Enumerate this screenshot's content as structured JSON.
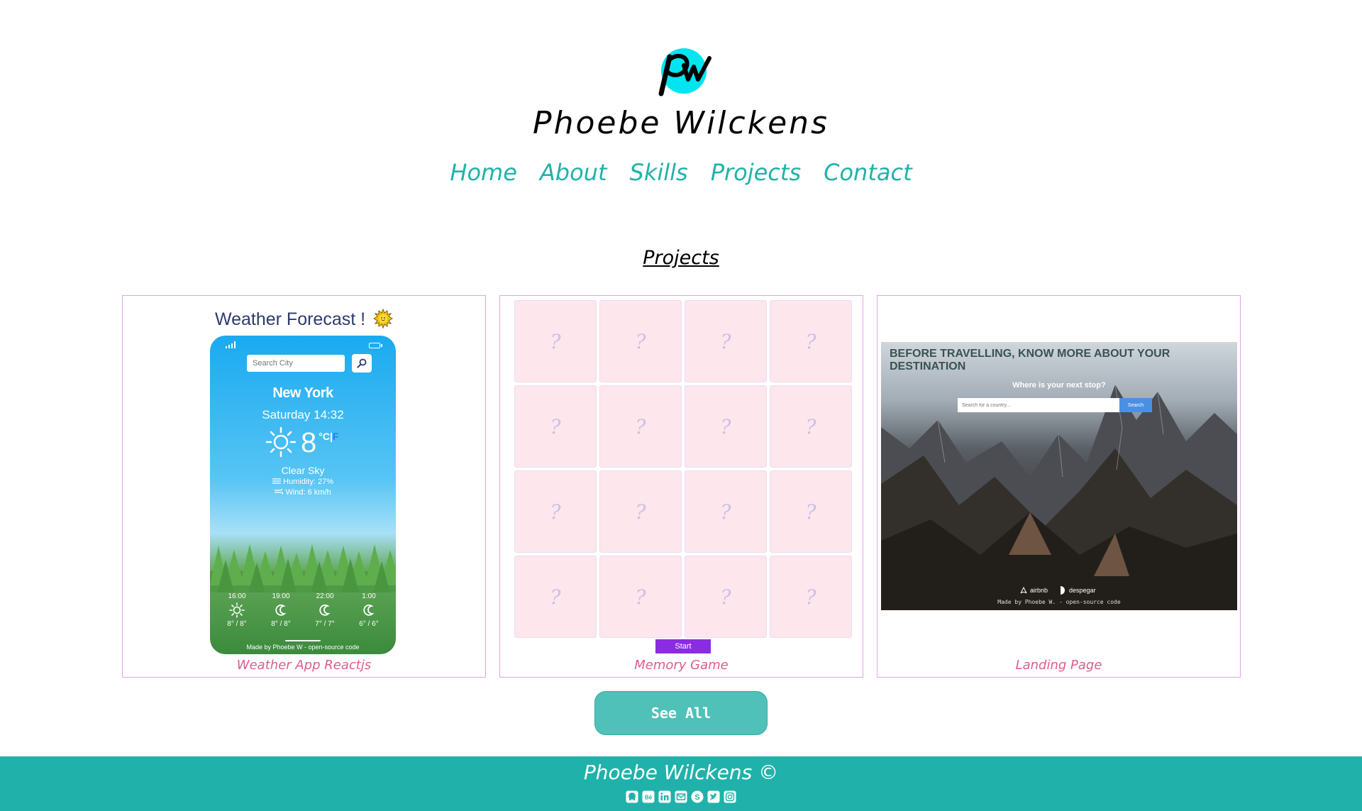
{
  "header": {
    "logo_text": "pw",
    "site_title": "Phoebe Wilckens",
    "nav": [
      "Home",
      "About",
      "Skills",
      "Projects",
      "Contact"
    ]
  },
  "projects": {
    "title": "Projects",
    "cards": [
      {
        "caption": "Weather App Reactjs",
        "preview": {
          "title": "Weather Forecast !",
          "search_placeholder": "Search City",
          "city": "New York",
          "date": "Saturday 14:32",
          "temperature": "8",
          "unit_c": "°C",
          "unit_sep": "|",
          "unit_f": "F",
          "description": "Clear Sky",
          "humidity": "Humidity: 27%",
          "wind": "Wind: 6 km/h",
          "forecast": [
            {
              "time": "16:00",
              "temps": "8° / 8°",
              "icon": "sun-icon"
            },
            {
              "time": "19:00",
              "temps": "8° / 8°",
              "icon": "moon-icon"
            },
            {
              "time": "22:00",
              "temps": "7° / 7°",
              "icon": "moon-icon"
            },
            {
              "time": "1:00",
              "temps": "6° / 6°",
              "icon": "moon-icon"
            }
          ],
          "credit": "Made by Phoebe W - open-source code"
        }
      },
      {
        "caption": "Memory Game",
        "preview": {
          "tiles": [
            "?",
            "?",
            "?",
            "?",
            "?",
            "?",
            "?",
            "?",
            "?",
            "?",
            "?",
            "?",
            "?",
            "?",
            "?",
            "?"
          ],
          "start_label": "Start"
        }
      },
      {
        "caption": "Landing Page",
        "preview": {
          "headline": "BEFORE TRAVELLING, KNOW MORE ABOUT YOUR DESTINATION",
          "question": "Where is your next stop?",
          "search_placeholder": "Search for a country...",
          "search_label": "Search",
          "logo_1": "airbnb",
          "logo_2": "despegar",
          "credit": "Made by Phoebe W. - open-source code"
        }
      }
    ],
    "see_all_label": "See All"
  },
  "footer": {
    "name": "Phoebe Wilckens ©",
    "social_icons": [
      "github-icon",
      "behance-icon",
      "linkedin-icon",
      "email-icon",
      "skype-icon",
      "twitter-icon",
      "instagram-icon"
    ]
  },
  "colors": {
    "accent": "#20b2aa",
    "button": "#4fc1b9",
    "caption": "#e05c8f",
    "card_border": "#e0a4e6",
    "logo_circle": "#00e5f0"
  }
}
